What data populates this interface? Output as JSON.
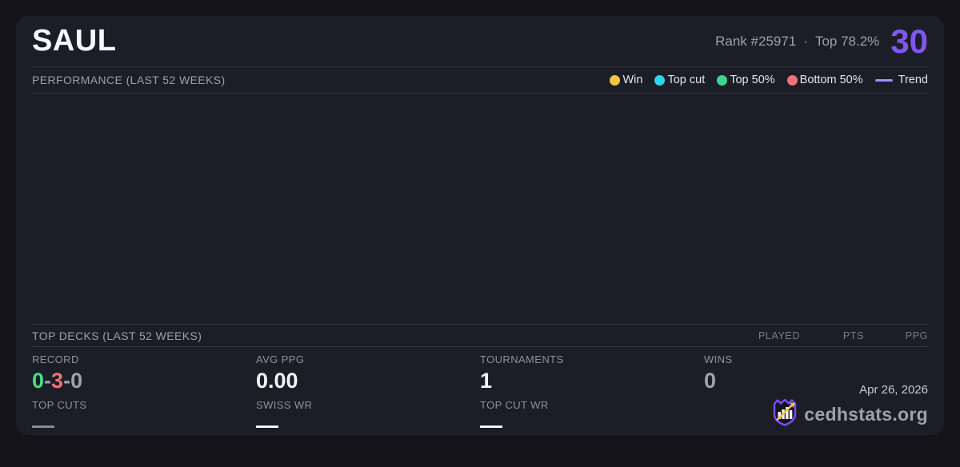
{
  "header": {
    "title": "SAUL",
    "rank": "Rank #25971",
    "separator": "·",
    "top_percent": "Top 78.2%",
    "score": "30",
    "score_color": "#8156f0"
  },
  "performance": {
    "title": "PERFORMANCE (LAST 52 WEEKS)",
    "legend": [
      {
        "label": "Win",
        "color": "#f5c542"
      },
      {
        "label": "Top cut",
        "color": "#2ed3ee"
      },
      {
        "label": "Top 50%",
        "color": "#3dd68c"
      },
      {
        "label": "Bottom 50%",
        "color": "#f47174"
      }
    ],
    "trend": {
      "label": "Trend",
      "color": "#a78bfa"
    },
    "chart_empty": true
  },
  "top_decks": {
    "title": "TOP DECKS (LAST 52 WEEKS)",
    "columns": [
      "PLAYED",
      "PTS",
      "PPG"
    ]
  },
  "stats": {
    "record": {
      "label": "RECORD",
      "parts": [
        {
          "text": "0",
          "color": "#4ade80"
        },
        {
          "text": "-",
          "color": "#9ca3af"
        },
        {
          "text": "3",
          "color": "#f47174"
        },
        {
          "text": "-",
          "color": "#9ca3af"
        },
        {
          "text": "0",
          "color": "#9ca3af"
        }
      ]
    },
    "avg_ppg": {
      "label": "AVG PPG",
      "value": "0.00"
    },
    "tournaments": {
      "label": "TOURNAMENTS",
      "value": "1"
    },
    "wins": {
      "label": "WINS",
      "value": "0",
      "color": "#9ca3af"
    },
    "top_cuts": {
      "label": "TOP CUTS",
      "value": "—",
      "color": "#8b919d"
    },
    "swiss_wr": {
      "label": "SWISS WR",
      "value": "—",
      "color": "#ffffff"
    },
    "top_cut_wr": {
      "label": "TOP CUT WR",
      "value": "—",
      "color": "#ffffff"
    }
  },
  "footer": {
    "date": "Apr 26, 2026",
    "brand": "cedhstats.org",
    "logo_colors": {
      "shield": "#7c4dff",
      "bars": "#ffffff",
      "arrow": "#f5c542"
    }
  }
}
